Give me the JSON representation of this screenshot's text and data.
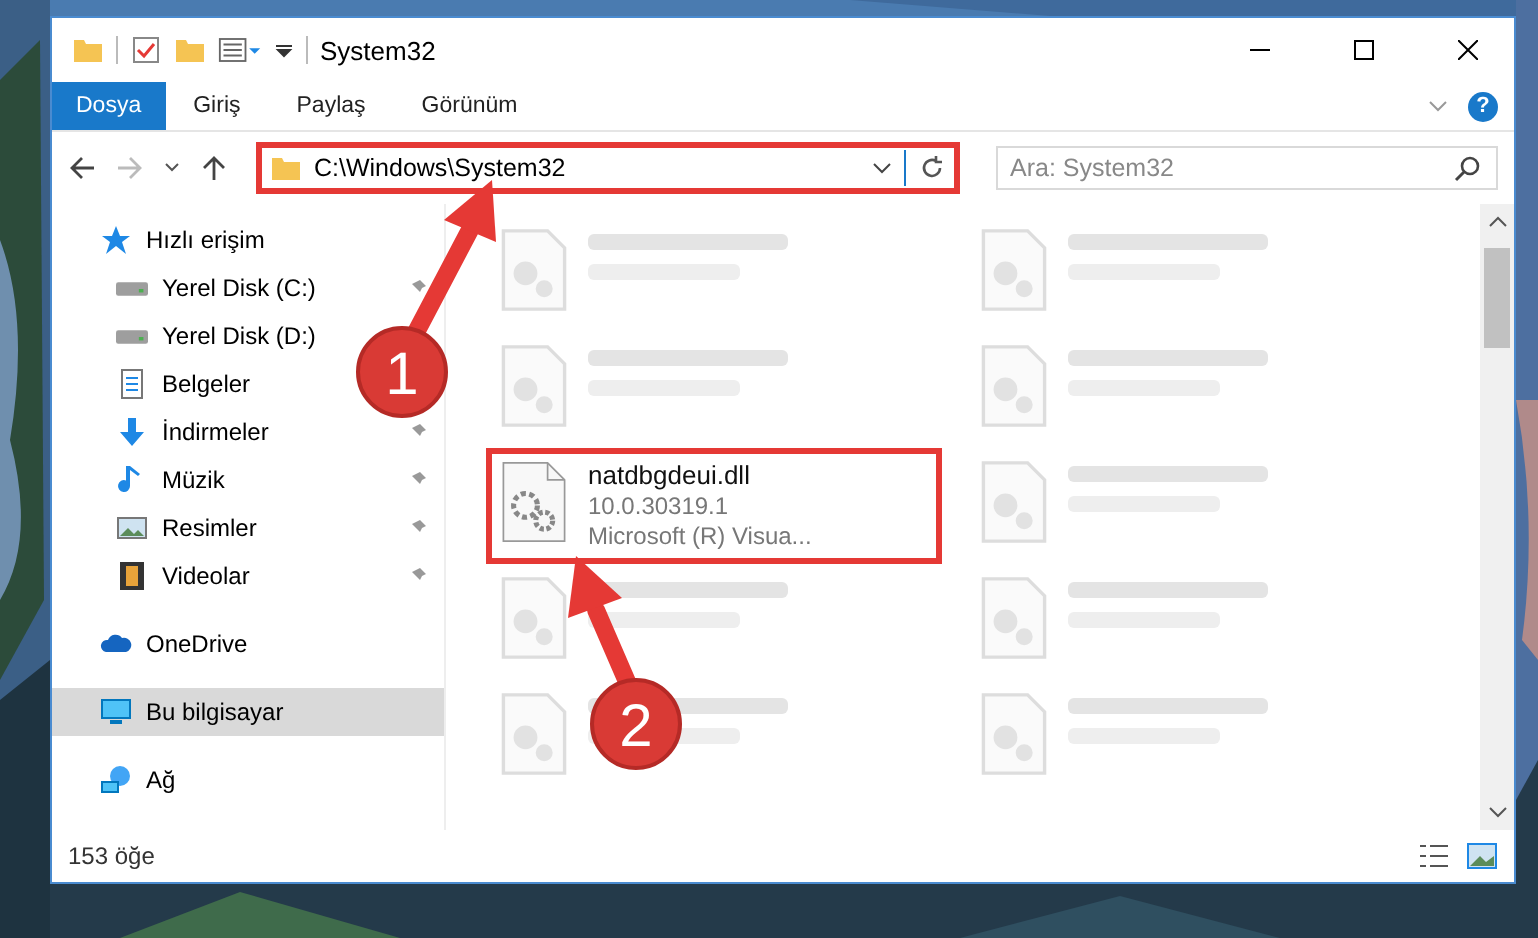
{
  "window": {
    "title": "System32"
  },
  "ribbon_tabs": [
    {
      "label": "Dosya",
      "selected": true
    },
    {
      "label": "Giriş",
      "selected": false
    },
    {
      "label": "Paylaş",
      "selected": false
    },
    {
      "label": "Görünüm",
      "selected": false
    }
  ],
  "help": "?",
  "address_bar": {
    "path": "C:\\Windows\\System32",
    "highlighted": true
  },
  "search": {
    "placeholder": "Ara: System32"
  },
  "sidebar": {
    "items": [
      {
        "label": "Hızlı erişim",
        "kind": "quick",
        "selected": false,
        "pinned": false,
        "children": [
          {
            "label": "Yerel Disk (C:)",
            "kind": "drive",
            "selected": false,
            "pinned": true
          },
          {
            "label": "Yerel Disk (D:)",
            "kind": "drive",
            "selected": false
          },
          {
            "label": "Belgeler",
            "kind": "docs",
            "selected": false
          },
          {
            "label": "İndirmeler",
            "kind": "downloads",
            "selected": false,
            "pinned": true
          },
          {
            "label": "Müzik",
            "kind": "music",
            "selected": false,
            "pinned": true
          },
          {
            "label": "Resimler",
            "kind": "pictures",
            "selected": false,
            "pinned": true
          },
          {
            "label": "Videolar",
            "kind": "videos",
            "selected": false,
            "pinned": true
          }
        ]
      },
      {
        "label": "OneDrive",
        "kind": "cloud",
        "selected": false,
        "pinned": false
      },
      {
        "label": "Bu bilgisayar",
        "kind": "pc",
        "selected": true,
        "pinned": false
      },
      {
        "label": "Ağ",
        "kind": "network",
        "selected": false,
        "pinned": false
      }
    ]
  },
  "files": [
    {
      "blurred": true,
      "highlighted": false
    },
    {
      "blurred": true,
      "highlighted": false
    },
    {
      "blurred": true,
      "highlighted": false
    },
    {
      "blurred": true,
      "highlighted": false
    },
    {
      "name": "natdbgdeui.dll",
      "details": [
        "10.0.30319.1",
        "Microsoft (R) Visua..."
      ],
      "blurred": false,
      "highlighted": true
    },
    {
      "blurred": true,
      "highlighted": false
    },
    {
      "blurred": true,
      "highlighted": false
    },
    {
      "blurred": true,
      "highlighted": false
    },
    {
      "blurred": true,
      "highlighted": false
    },
    {
      "blurred": true,
      "highlighted": false
    }
  ],
  "status_bar": {
    "count": "153 öğe"
  },
  "annotations": [
    {
      "number": "1"
    },
    {
      "number": "2"
    }
  ]
}
